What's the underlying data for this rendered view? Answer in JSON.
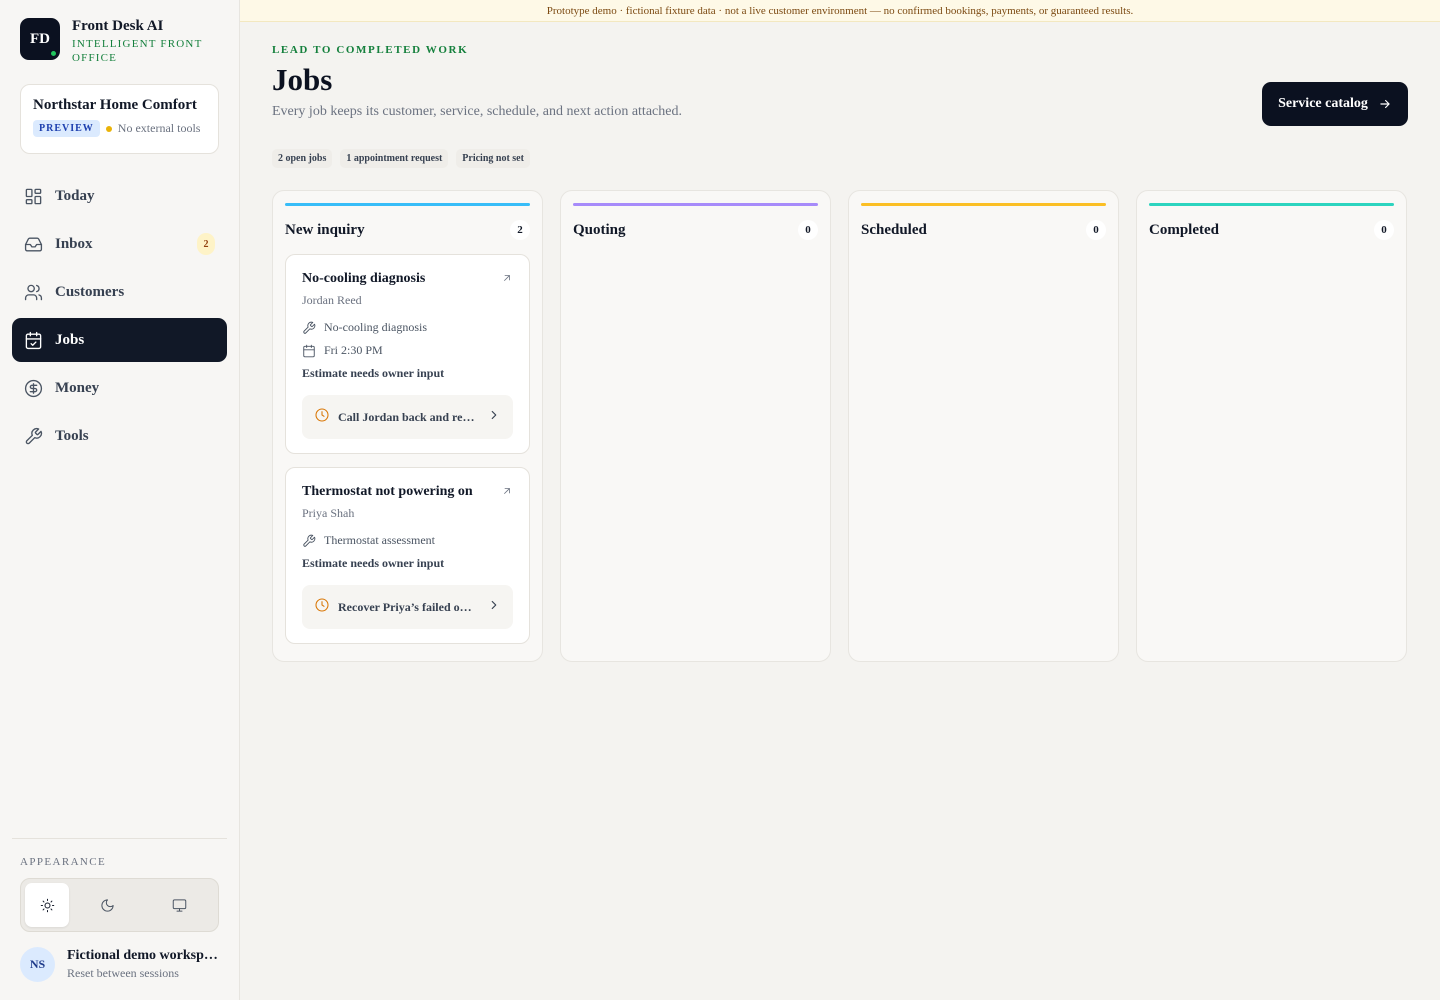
{
  "banner": "Prototype demo · fictional fixture data · not a live customer environment — no confirmed bookings, payments, or guaranteed results.",
  "brand": {
    "initials": "FD",
    "name": "Front Desk AI",
    "tagline": "Intelligent front office"
  },
  "workspace": {
    "name": "Northstar Home Comfort",
    "badge": "PREVIEW",
    "status": "No external tools"
  },
  "nav": [
    {
      "label": "Today",
      "icon": "dashboard-icon"
    },
    {
      "label": "Inbox",
      "icon": "inbox-icon",
      "count": "2"
    },
    {
      "label": "Customers",
      "icon": "users-icon"
    },
    {
      "label": "Jobs",
      "icon": "calendar-check-icon",
      "active": true
    },
    {
      "label": "Money",
      "icon": "dollar-circle-icon"
    },
    {
      "label": "Tools",
      "icon": "wrench-icon"
    }
  ],
  "appearance": {
    "label": "Appearance",
    "options": [
      "light-theme-icon",
      "dark-theme-icon",
      "system-theme-icon"
    ],
    "selected": "light"
  },
  "user": {
    "initials": "NS",
    "name": "Fictional demo workspace",
    "sub": "Reset between sessions"
  },
  "header": {
    "eyebrow": "Lead to completed work",
    "title": "Jobs",
    "subtitle": "Every job keeps its customer, service, schedule, and next action attached.",
    "catalog_button": "Service catalog"
  },
  "chips": [
    "2 open jobs",
    "1 appointment request",
    "Pricing not set"
  ],
  "columns": [
    {
      "name": "New inquiry",
      "count": "2",
      "color": "#38bdf8",
      "jobs": [
        {
          "title": "No-cooling diagnosis",
          "customer": "Jordan Reed",
          "service": "No-cooling diagnosis",
          "time": "Fri 2:30 PM",
          "status": "Estimate needs owner input",
          "next_action": "Call Jordan back and re…"
        },
        {
          "title": "Thermostat not powering on",
          "customer": "Priya Shah",
          "service": "Thermostat assessment",
          "status": "Estimate needs owner input",
          "next_action": "Recover Priya’s failed o…"
        }
      ]
    },
    {
      "name": "Quoting",
      "count": "0",
      "color": "#a78bfa",
      "jobs": []
    },
    {
      "name": "Scheduled",
      "count": "0",
      "color": "#fbbf24",
      "jobs": []
    },
    {
      "name": "Completed",
      "count": "0",
      "color": "#2dd4bf",
      "jobs": []
    }
  ]
}
